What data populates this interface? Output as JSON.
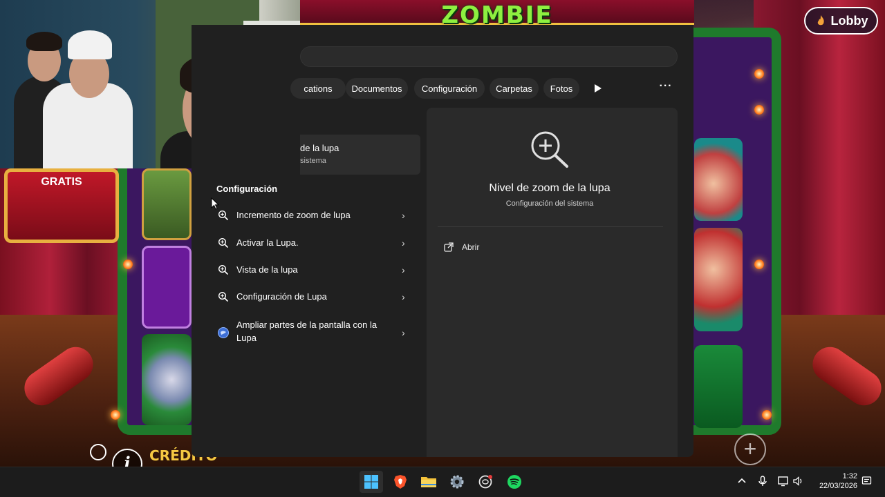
{
  "game": {
    "title": "ZOMBIE",
    "free_spin_label": "GRATIS",
    "lobby_label": "Lobby",
    "credit_label": "CRÉDITO"
  },
  "search": {
    "filters": [
      {
        "label": "cations"
      },
      {
        "label": "Documentos"
      },
      {
        "label": "Configuración"
      },
      {
        "label": "Carpetas"
      },
      {
        "label": "Fotos"
      }
    ],
    "more_filters_icon": "play-arrow-icon",
    "ellipsis": "···",
    "best_match": {
      "title": "de la lupa",
      "subtitle": "sistema"
    },
    "section_heading": "Configuración",
    "results": [
      {
        "label": "Incremento de zoom de lupa",
        "icon": "magnifier-icon"
      },
      {
        "label": "Activar la Lupa.",
        "icon": "magnifier-icon"
      },
      {
        "label": "Vista de la lupa",
        "icon": "magnifier-icon"
      },
      {
        "label": "Configuración de Lupa",
        "icon": "magnifier-icon"
      },
      {
        "label": "Ampliar partes de la pantalla con la Lupa",
        "icon": "globe-icon"
      }
    ],
    "detail": {
      "title": "Nivel de zoom de la lupa",
      "subtitle": "Configuración del sistema",
      "open_label": "Abrir"
    }
  },
  "taskbar": {
    "apps": [
      "windows-start-icon",
      "brave-browser-icon",
      "file-explorer-icon",
      "settings-gear-icon",
      "chatgpt-icon",
      "spotify-icon"
    ],
    "time": "1:32",
    "date": "22/03/2026"
  },
  "colors": {
    "flyout_bg": "#202020",
    "detail_bg": "#2a2a2a",
    "taskbar_bg": "#1c1c1c",
    "accent_blue": "#4cc2ff",
    "spotify_green": "#1ed760",
    "brave_orange": "#fb542b"
  }
}
